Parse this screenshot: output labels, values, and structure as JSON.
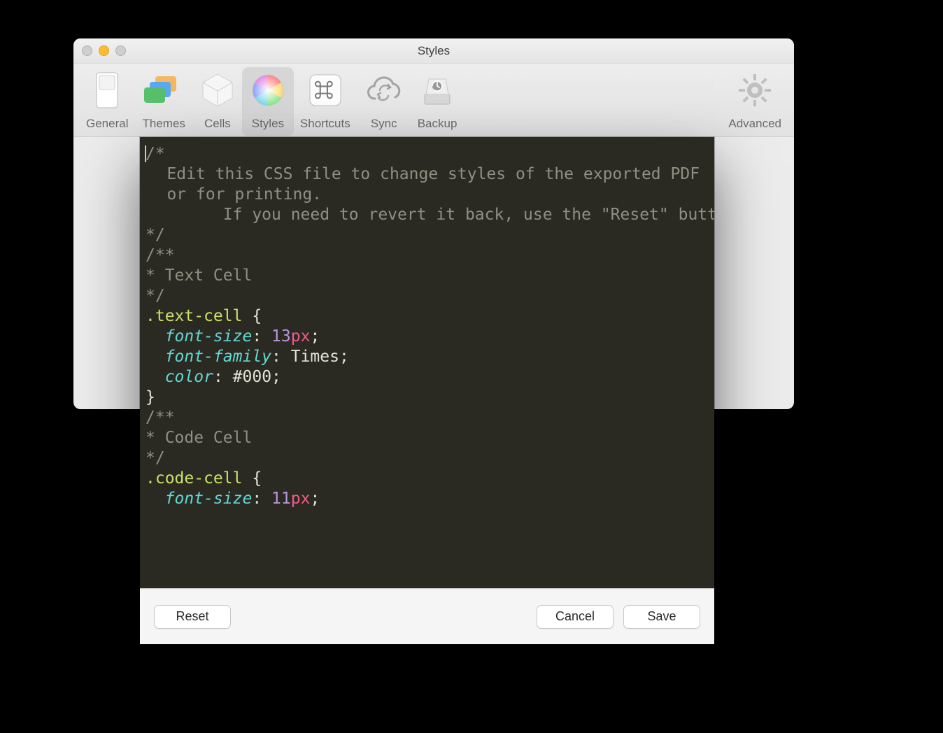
{
  "window": {
    "title": "Styles"
  },
  "toolbar": {
    "tabs": [
      {
        "id": "general",
        "label": "General"
      },
      {
        "id": "themes",
        "label": "Themes"
      },
      {
        "id": "cells",
        "label": "Cells"
      },
      {
        "id": "styles",
        "label": "Styles"
      },
      {
        "id": "shortcuts",
        "label": "Shortcuts"
      },
      {
        "id": "sync",
        "label": "Sync"
      },
      {
        "id": "backup",
        "label": "Backup"
      }
    ],
    "advanced": {
      "label": "Advanced"
    },
    "selectedId": "styles"
  },
  "editor": {
    "lines": [
      [
        {
          "t": "/*",
          "c": "cmt"
        }
      ],
      [
        {
          "t": "\tEdit this CSS file to change styles of the exported PDF or for printing.",
          "c": "cmt",
          "wrap": true
        }
      ],
      [
        {
          "t": "\tIf you need to revert it back, use the \"Reset\" button.",
          "c": "cmt"
        }
      ],
      [
        {
          "t": "*/",
          "c": "cmt"
        }
      ],
      [
        {
          "t": "",
          "c": "cmt"
        }
      ],
      [
        {
          "t": "/**",
          "c": "cmt"
        }
      ],
      [
        {
          "t": "* Text Cell",
          "c": "cmt"
        }
      ],
      [
        {
          "t": "*/",
          "c": "cmt"
        }
      ],
      [
        {
          "t": "",
          "c": "cmt"
        }
      ],
      [
        {
          "t": ".text-cell",
          "c": "sel"
        },
        {
          "t": " {",
          "c": "punc"
        }
      ],
      [
        {
          "t": "  ",
          "c": "punc"
        },
        {
          "t": "font-size",
          "c": "prop"
        },
        {
          "t": ": ",
          "c": "punc"
        },
        {
          "t": "13",
          "c": "num"
        },
        {
          "t": "px",
          "c": "unit"
        },
        {
          "t": ";",
          "c": "punc"
        }
      ],
      [
        {
          "t": "  ",
          "c": "punc"
        },
        {
          "t": "font-family",
          "c": "prop"
        },
        {
          "t": ": ",
          "c": "punc"
        },
        {
          "t": "Times",
          "c": "val"
        },
        {
          "t": ";",
          "c": "punc"
        }
      ],
      [
        {
          "t": "  ",
          "c": "punc"
        },
        {
          "t": "color",
          "c": "prop"
        },
        {
          "t": ": ",
          "c": "punc"
        },
        {
          "t": "#000",
          "c": "val"
        },
        {
          "t": ";",
          "c": "punc"
        }
      ],
      [
        {
          "t": "}",
          "c": "punc"
        }
      ],
      [
        {
          "t": "",
          "c": "cmt"
        }
      ],
      [
        {
          "t": "/**",
          "c": "cmt"
        }
      ],
      [
        {
          "t": "* Code Cell",
          "c": "cmt"
        }
      ],
      [
        {
          "t": "*/",
          "c": "cmt"
        }
      ],
      [
        {
          "t": "",
          "c": "cmt"
        }
      ],
      [
        {
          "t": ".code-cell",
          "c": "sel"
        },
        {
          "t": " {",
          "c": "punc"
        }
      ],
      [
        {
          "t": "  ",
          "c": "punc"
        },
        {
          "t": "font-size",
          "c": "prop"
        },
        {
          "t": ": ",
          "c": "punc"
        },
        {
          "t": "11",
          "c": "num"
        },
        {
          "t": "px",
          "c": "unit"
        },
        {
          "t": ";",
          "c": "punc"
        }
      ]
    ]
  },
  "footer": {
    "reset": "Reset",
    "cancel": "Cancel",
    "save": "Save"
  }
}
